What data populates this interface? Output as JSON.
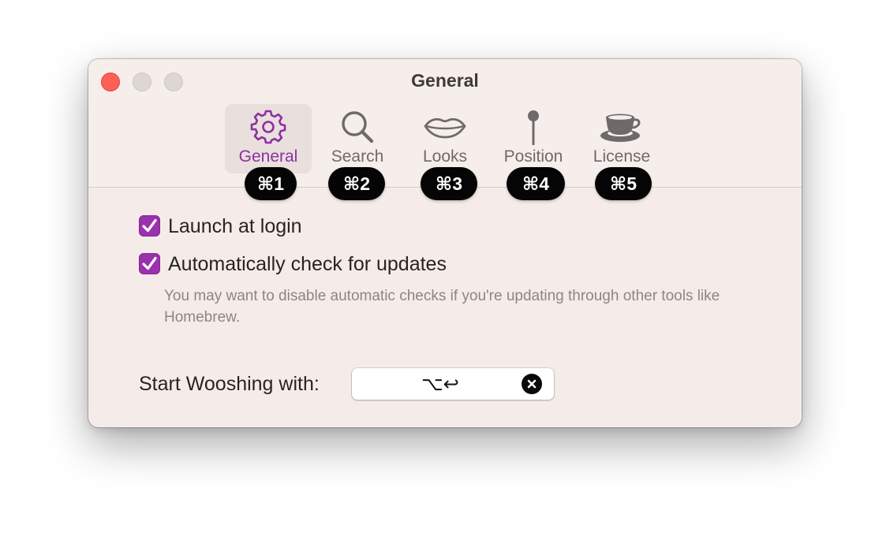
{
  "window": {
    "title": "General"
  },
  "tabs": [
    {
      "label": "General",
      "icon": "gear-icon",
      "shortcut": "⌘1",
      "selected": true
    },
    {
      "label": "Search",
      "icon": "search-icon",
      "shortcut": "⌘2",
      "selected": false
    },
    {
      "label": "Looks",
      "icon": "lips-icon",
      "shortcut": "⌘3",
      "selected": false
    },
    {
      "label": "Position",
      "icon": "pin-icon",
      "shortcut": "⌘4",
      "selected": false
    },
    {
      "label": "License",
      "icon": "coffee-cup-icon",
      "shortcut": "⌘5",
      "selected": false
    }
  ],
  "settings": {
    "launch_at_login": {
      "label": "Launch at login",
      "checked": true
    },
    "auto_updates": {
      "label": "Automatically check for updates",
      "checked": true
    },
    "auto_updates_hint": "You may want to disable automatic checks if you're updating through other tools like Homebrew."
  },
  "shortcut": {
    "label": "Start Wooshing with:",
    "value": "⌥↩"
  },
  "colors": {
    "accent": "#9a31ad",
    "window_bg": "#f5ece9",
    "close_button": "#fe5f57",
    "badge_bg": "#050505"
  }
}
